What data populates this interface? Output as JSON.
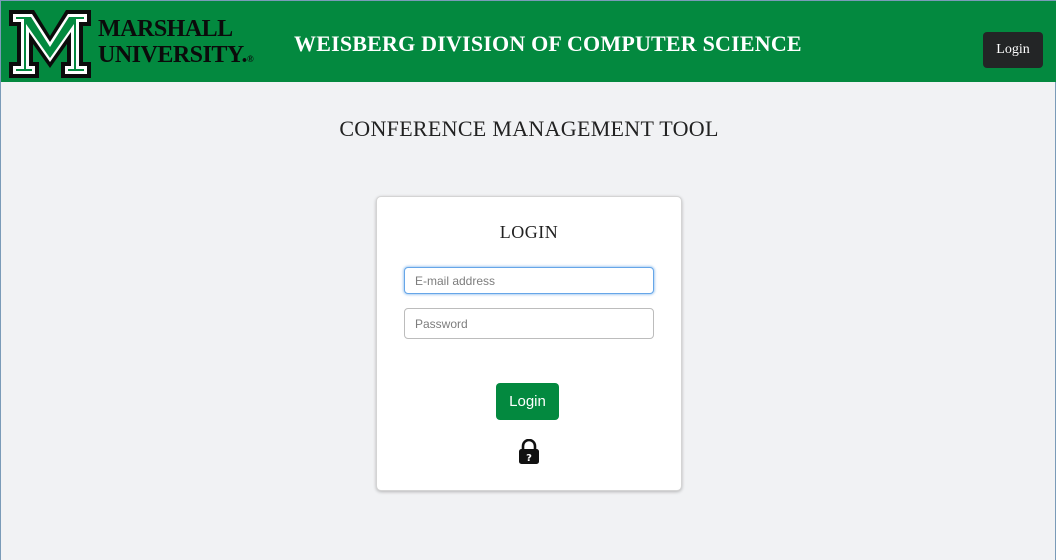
{
  "header": {
    "logo_line1": "MARSHALL",
    "logo_line2": "UNIVERSITY.",
    "logo_reg": "®",
    "department_title": "WEISBERG DIVISION OF COMPUTER SCIENCE",
    "login_button": "Login",
    "brand_color": "#03893f"
  },
  "main": {
    "app_title": "CONFERENCE MANAGEMENT TOOL"
  },
  "login_card": {
    "title": "LOGIN",
    "email_placeholder": "E-mail address",
    "email_value": "",
    "password_placeholder": "Password",
    "password_value": "",
    "submit_label": "Login",
    "help_icon": "lock-question-icon"
  }
}
